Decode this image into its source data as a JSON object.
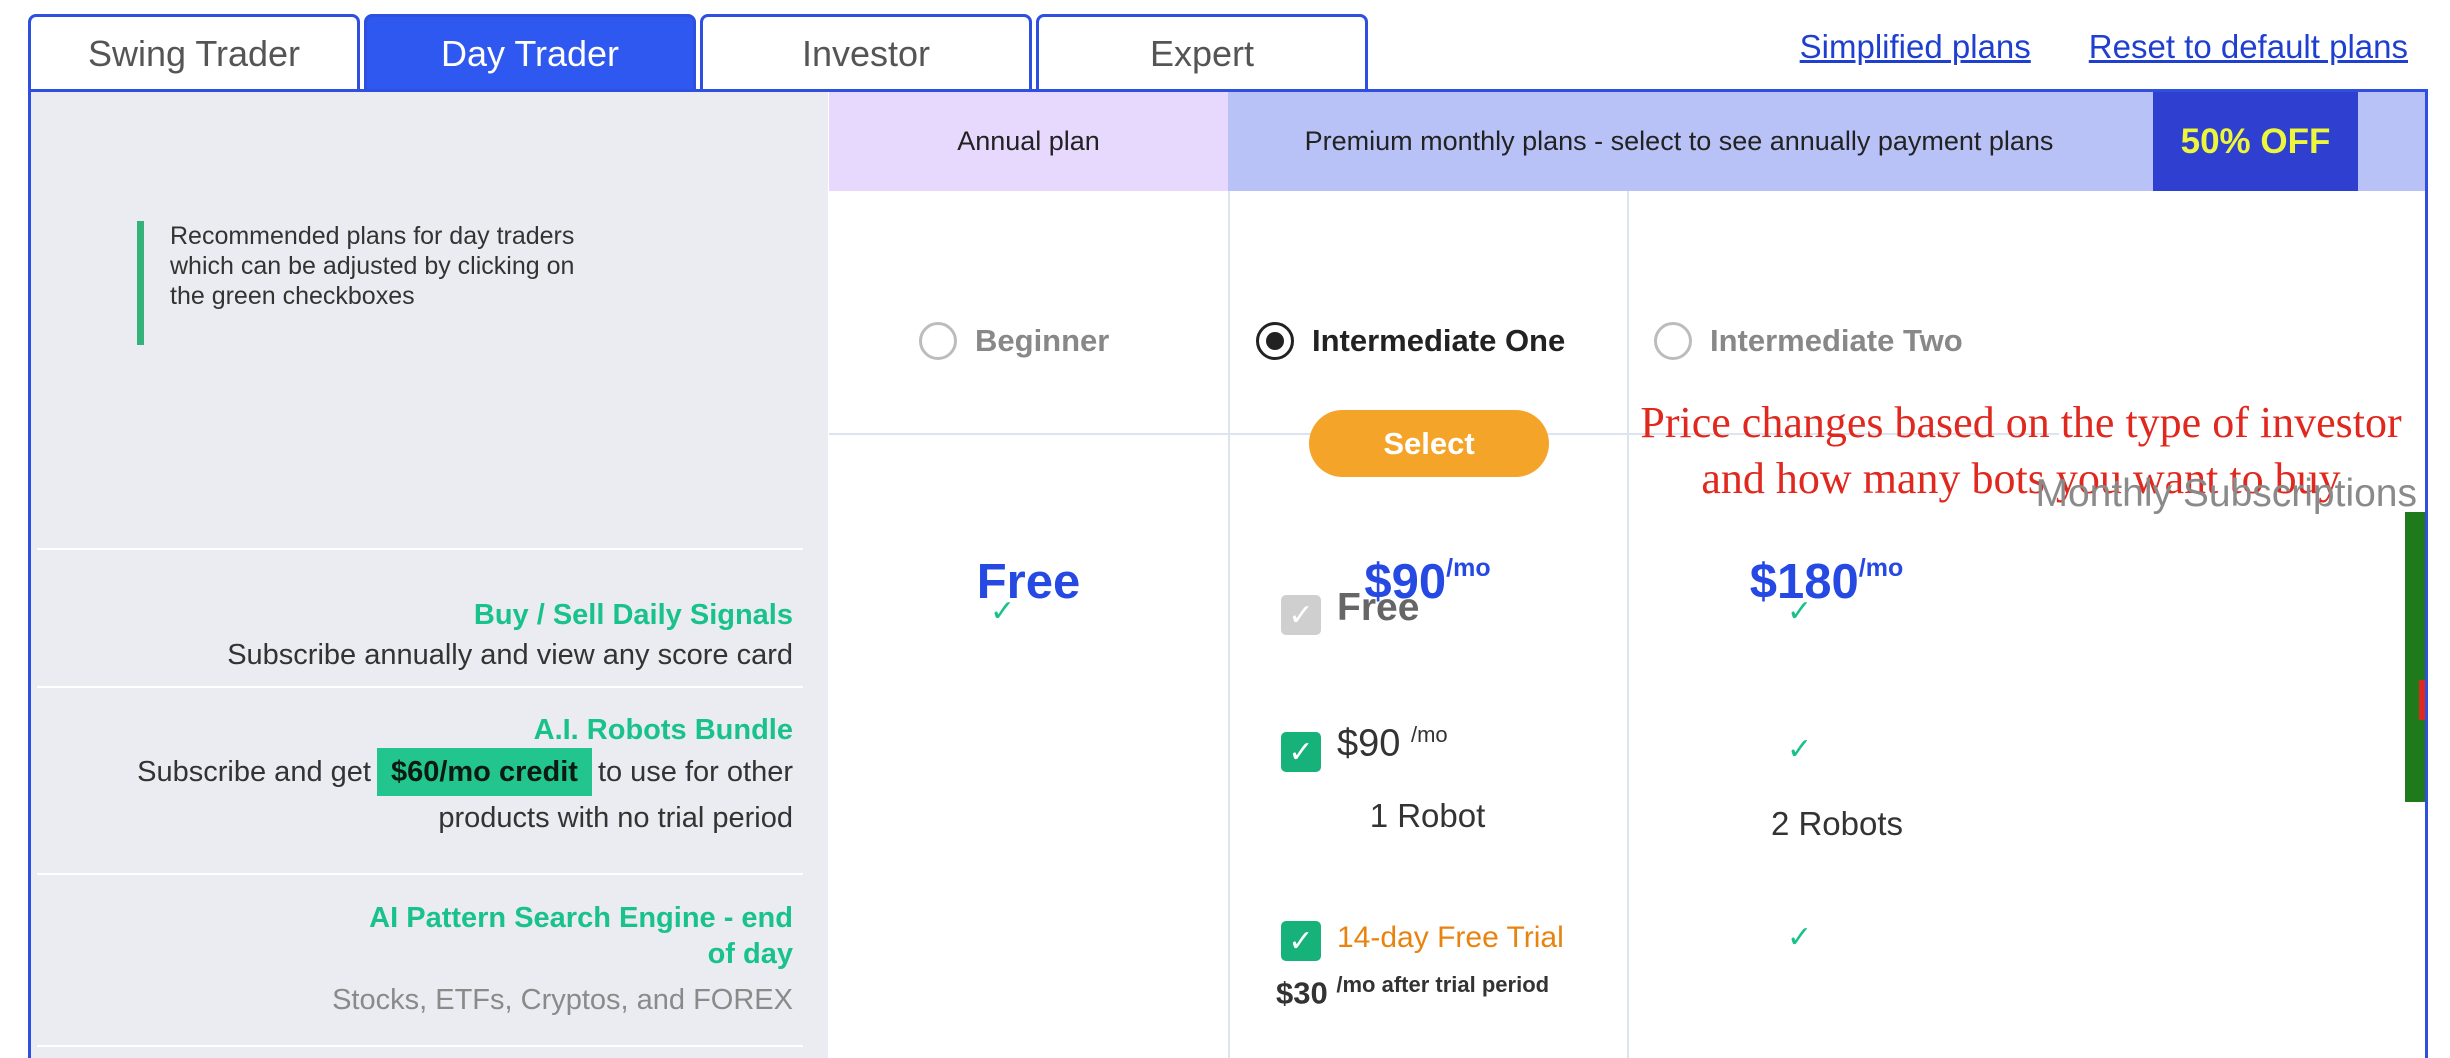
{
  "tabs": [
    "Swing Trader",
    "Day Trader",
    "Investor",
    "Expert"
  ],
  "active_tab": 1,
  "links": {
    "simplified": "Simplified plans",
    "reset": "Reset to default plans"
  },
  "recommendation": [
    "Recommended plans for day traders",
    "which can be adjusted by clicking on",
    "the green checkboxes"
  ],
  "header": {
    "annual": "Annual plan",
    "premium": "Premium monthly plans - select to see annually payment plans",
    "badge": "50% OFF"
  },
  "plans": [
    {
      "name": "Beginner",
      "selected": false
    },
    {
      "name": "Intermediate One",
      "selected": true
    },
    {
      "name": "Intermediate Two",
      "selected": false
    }
  ],
  "select_label": "Select",
  "annotation": [
    "Price changes based on the type of investor",
    "and how many bots you want to buy"
  ],
  "monthly": {
    "title": "Monthly Subscriptions",
    "prices": [
      "Free",
      "$90",
      "$180"
    ],
    "per_mo": "/mo"
  },
  "features": {
    "signals": {
      "title": "Buy / Sell Daily Signals",
      "desc": "Subscribe annually and view any score card",
      "col2": "Free"
    },
    "robots": {
      "title": "A.I. Robots Bundle",
      "desc_a": "Subscribe and get",
      "credit": "$60/mo credit",
      "desc_b": "to use for other",
      "desc_c": "products with no trial period",
      "col2_price": "$90",
      "col2_unit": "/mo",
      "col2_count": "1 Robot",
      "col3_count": "2 Robots"
    },
    "pattern": {
      "title_a": "AI Pattern Search Engine - end",
      "title_b": "of day",
      "desc": "Stocks, ETFs, Cryptos, and FOREX",
      "col2_trial": "14-day Free Trial",
      "col2_price": "$30",
      "col2_after": "/mo after trial period"
    }
  },
  "check_glyph": "✓",
  "colors": {
    "tab_blue": "#2f58f0",
    "price_blue": "#2549e2",
    "feature_green": "#18c28a",
    "select_orange": "#f5a42a",
    "badge_yellow": "#ecf63b",
    "annotation_red": "#e0281e"
  }
}
